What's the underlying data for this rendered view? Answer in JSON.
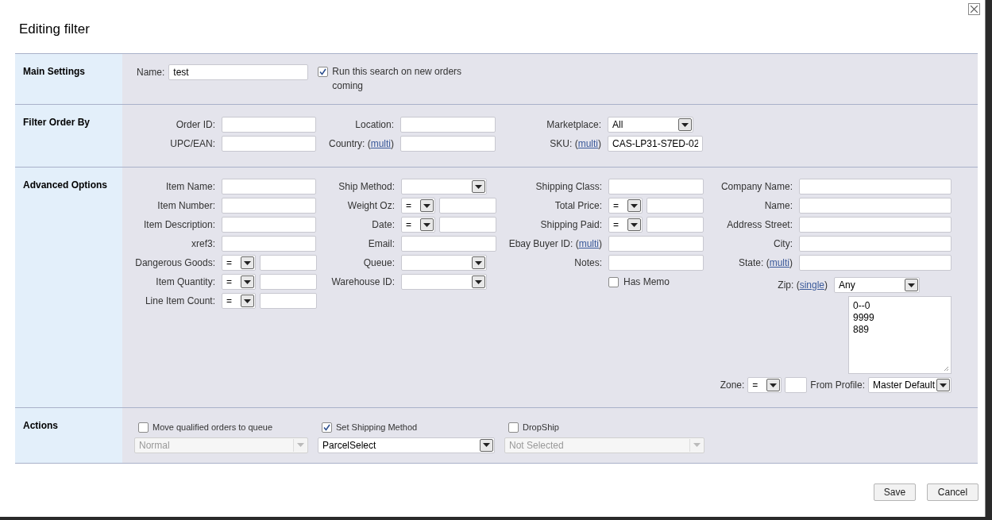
{
  "window": {
    "title": "Editing filter"
  },
  "main_settings": {
    "title": "Main Settings",
    "name_label": "Name:",
    "name_value": "test",
    "run_on_new": {
      "label": "Run this search on new orders coming",
      "checked": true
    }
  },
  "filter_order_by": {
    "title": "Filter Order By",
    "columns": [
      [
        {
          "kind": "text",
          "label": "Order ID:"
        },
        {
          "kind": "text",
          "label": "UPC/EAN:"
        }
      ],
      [
        {
          "kind": "text",
          "label": "Location:"
        },
        {
          "kind": "text",
          "label": "Country: (",
          "link": "multi",
          "after": ")"
        }
      ],
      [
        {
          "kind": "select",
          "label": "Marketplace:",
          "value": "All"
        },
        {
          "kind": "text",
          "label": "SKU: (",
          "link": "multi",
          "after": ")",
          "value": "CAS-LP31-S7ED-02"
        }
      ]
    ]
  },
  "advanced_options": {
    "title": "Advanced Options",
    "columns": [
      [
        {
          "kind": "text",
          "label": "Item Name:"
        },
        {
          "kind": "text",
          "label": "Item Number:"
        },
        {
          "kind": "text",
          "label": "Item Description:"
        },
        {
          "kind": "text",
          "label": "xref3:"
        },
        {
          "kind": "compare",
          "label": "Dangerous Goods:",
          "operator": "="
        },
        {
          "kind": "compare",
          "label": "Item Quantity:",
          "operator": "="
        },
        {
          "kind": "compare",
          "label": "Line Item Count:",
          "operator": "="
        }
      ],
      [
        {
          "kind": "select",
          "label": "Ship Method:"
        },
        {
          "kind": "compare",
          "label": "Weight Oz:",
          "operator": "="
        },
        {
          "kind": "compare",
          "label": "Date:",
          "operator": "="
        },
        {
          "kind": "text",
          "label": "Email:"
        },
        {
          "kind": "select",
          "label": "Queue:"
        },
        {
          "kind": "select",
          "label": "Warehouse ID:"
        }
      ],
      [
        {
          "kind": "text",
          "label": "Shipping Class:"
        },
        {
          "kind": "compare",
          "label": "Total Price:",
          "operator": "="
        },
        {
          "kind": "compare",
          "label": "Shipping Paid:",
          "operator": "="
        },
        {
          "kind": "text",
          "label": "Ebay Buyer ID: (",
          "link": "multi",
          "after": ")"
        },
        {
          "kind": "text",
          "label": "Notes:"
        },
        {
          "kind": "checkbox",
          "label": "Has Memo",
          "checked": false
        }
      ],
      [
        {
          "kind": "text",
          "label": "Company Name:"
        },
        {
          "kind": "text",
          "label": "Name:"
        },
        {
          "kind": "text",
          "label": "Address Street:"
        },
        {
          "kind": "text",
          "label": "City:"
        },
        {
          "kind": "text",
          "label": "State: (",
          "link": "multi",
          "after": ")"
        },
        {
          "kind": "zip",
          "label": "Zip: (",
          "link": "single",
          "after": ")",
          "value": "Any"
        },
        {
          "kind": "textarea",
          "lines": [
            "0--0",
            "9999",
            "889"
          ]
        },
        {
          "kind": "zone",
          "label": "Zone:",
          "operator": "=",
          "profile_label": "From Profile:",
          "profile": "Master Default"
        }
      ]
    ]
  },
  "actions": {
    "title": "Actions",
    "items": [
      {
        "label": "Move qualified orders to queue",
        "checked": false,
        "select": "Normal",
        "disabled": true
      },
      {
        "label": "Set Shipping Method",
        "checked": true,
        "select": "ParcelSelect",
        "disabled": false
      },
      {
        "label": "DropShip",
        "checked": false,
        "select": "Not Selected",
        "disabled": true
      }
    ]
  },
  "buttons": [
    {
      "label": "Save"
    },
    {
      "label": "Cancel"
    }
  ]
}
